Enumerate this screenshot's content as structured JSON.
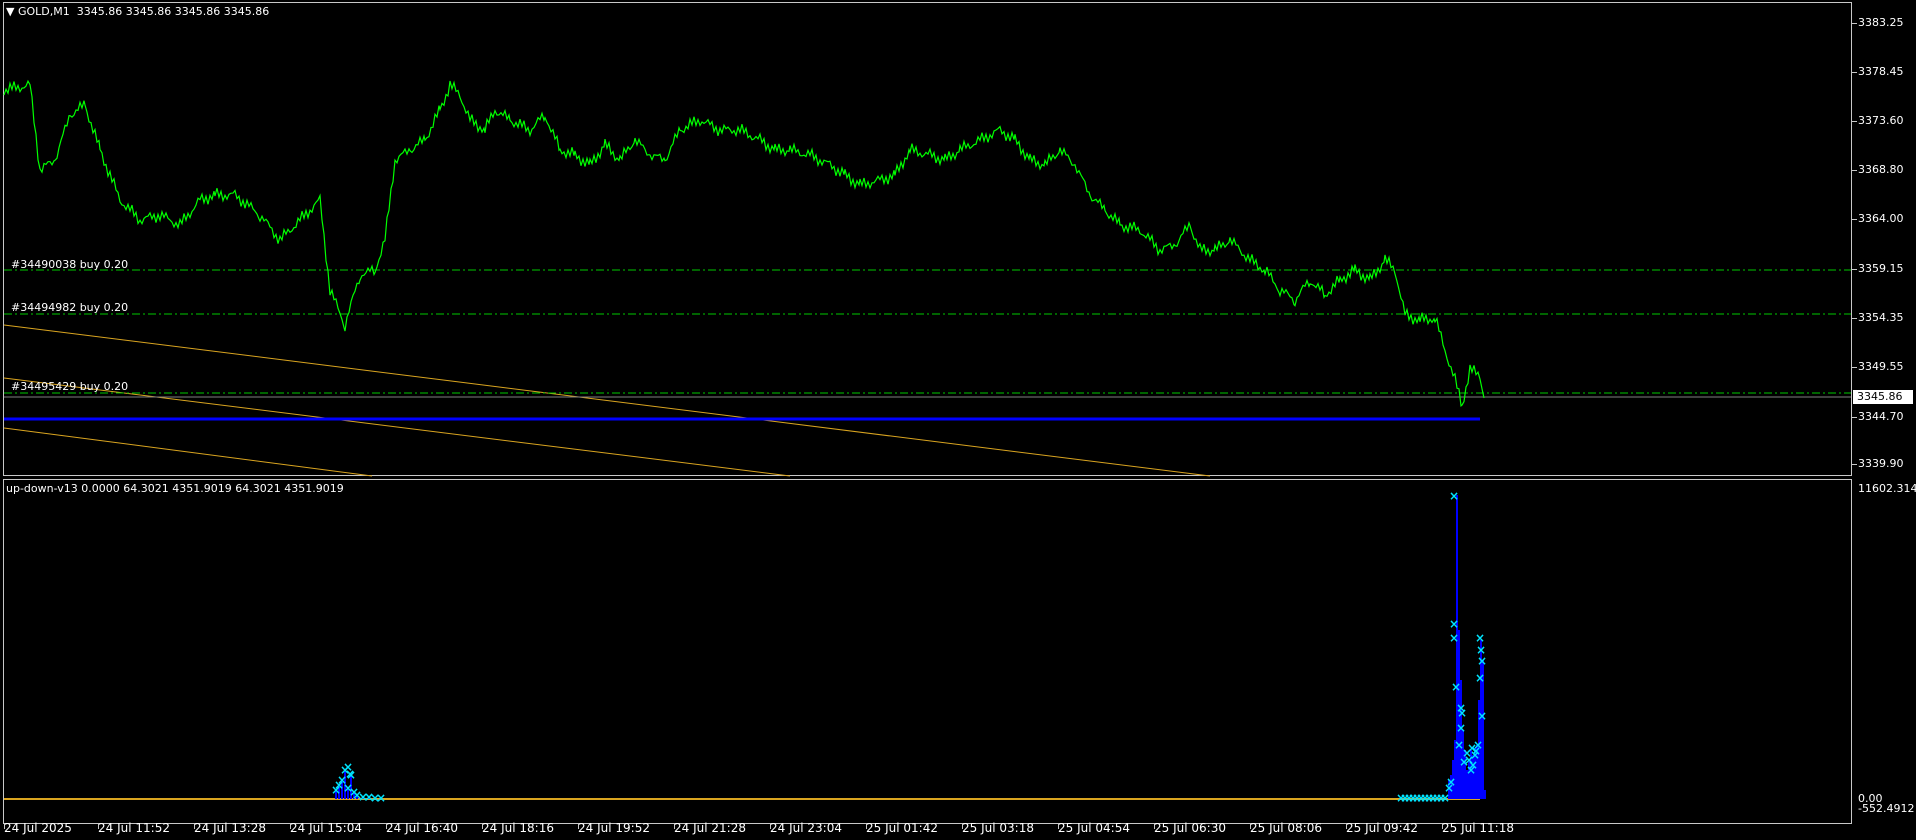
{
  "main": {
    "header_symbol": "GOLD,M1",
    "header_ohlc": "3345.86 3345.86 3345.86 3345.86",
    "order_lines": [
      {
        "label": "#34490038 buy 0.20",
        "price": 3358.5
      },
      {
        "label": "#34494982 buy 0.20",
        "price": 3354.1
      },
      {
        "label": "#34495429 buy 0.20",
        "price": 3346.2
      }
    ],
    "current_price": "3345.86",
    "y_scale": [
      "3383.25",
      "3378.45",
      "3373.60",
      "3368.80",
      "3364.00",
      "3359.15",
      "3354.35",
      "3349.55",
      "3344.70",
      "3339.90"
    ],
    "colors": {
      "price_line": "#00ff00",
      "order_line": "#00c800",
      "trend_line": "#daa520",
      "support_line": "#0000ff"
    }
  },
  "indicator": {
    "header": "up-down-v13 0.0000 64.3021 4351.9019 64.3021 4351.9019",
    "y_scale_top": "11602.314",
    "y_scale_zero": "0.00",
    "y_scale_bottom": "-552.4912",
    "colors": {
      "histogram": "#0000ff",
      "markers": "#00e5ff",
      "baseline": "#daa520"
    }
  },
  "x_axis": [
    "24 Jul 2025",
    "24 Jul 11:52",
    "24 Jul 13:28",
    "24 Jul 15:04",
    "24 Jul 16:40",
    "24 Jul 18:16",
    "24 Jul 19:52",
    "24 Jul 21:28",
    "24 Jul 23:04",
    "25 Jul 01:42",
    "25 Jul 03:18",
    "25 Jul 04:54",
    "25 Jul 06:30",
    "25 Jul 08:06",
    "25 Jul 09:42",
    "25 Jul 11:18"
  ]
}
